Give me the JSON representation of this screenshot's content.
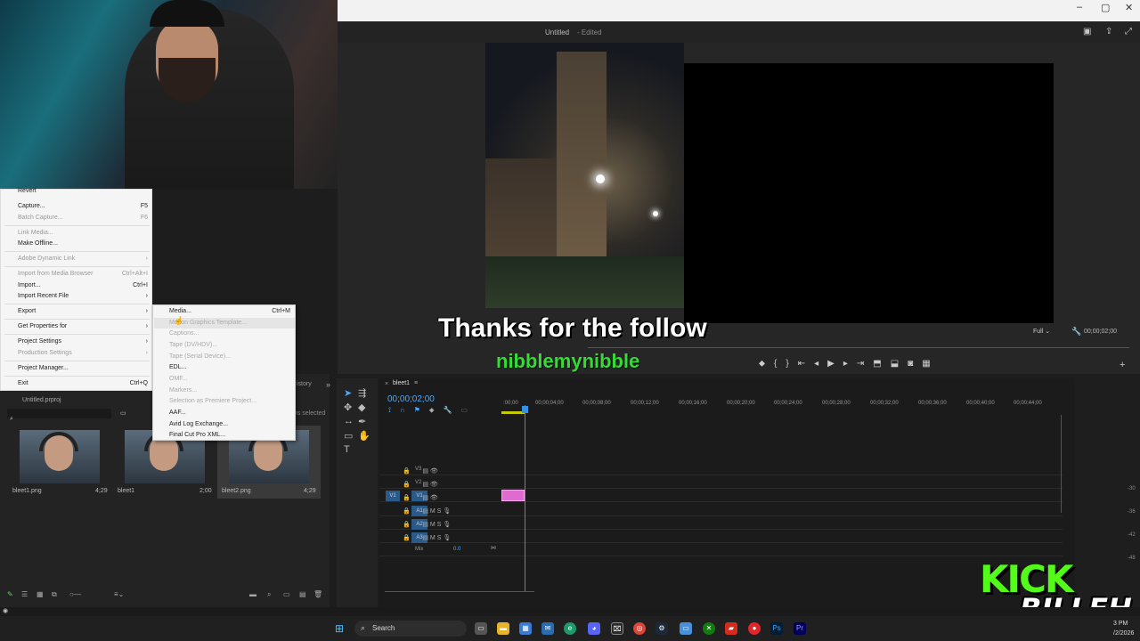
{
  "window": {
    "title": "Untitled",
    "state": "Edited"
  },
  "file_menu": {
    "items": [
      {
        "label": "Revert",
        "shortcut": "",
        "disabled": false
      },
      {
        "label": "Capture...",
        "shortcut": "F5",
        "disabled": false
      },
      {
        "label": "Batch Capture...",
        "shortcut": "F6",
        "disabled": true
      },
      {
        "label": "Link Media...",
        "shortcut": "",
        "disabled": true
      },
      {
        "label": "Make Offline...",
        "shortcut": "",
        "disabled": false
      },
      {
        "label": "Adobe Dynamic Link",
        "shortcut": "›",
        "disabled": true
      },
      {
        "label": "Import from Media Browser",
        "shortcut": "Ctrl+Alt+I",
        "disabled": true
      },
      {
        "label": "Import...",
        "shortcut": "Ctrl+I",
        "disabled": false
      },
      {
        "label": "Import Recent File",
        "shortcut": "›",
        "disabled": false
      },
      {
        "label": "Export",
        "shortcut": "›",
        "disabled": false
      },
      {
        "label": "Get Properties for",
        "shortcut": "›",
        "disabled": false
      },
      {
        "label": "Project Settings",
        "shortcut": "›",
        "disabled": false
      },
      {
        "label": "Production Settings",
        "shortcut": "›",
        "disabled": true
      },
      {
        "label": "Project Manager...",
        "shortcut": "",
        "disabled": false
      },
      {
        "label": "Exit",
        "shortcut": "Ctrl+Q",
        "disabled": false
      }
    ]
  },
  "export_menu": {
    "items": [
      {
        "label": "Media...",
        "shortcut": "Ctrl+M",
        "disabled": false
      },
      {
        "label": "Motion Graphics Template...",
        "shortcut": "",
        "disabled": true
      },
      {
        "label": "Captions...",
        "shortcut": "",
        "disabled": true
      },
      {
        "label": "Tape (DV/HDV)...",
        "shortcut": "",
        "disabled": true
      },
      {
        "label": "Tape (Serial Device)...",
        "shortcut": "",
        "disabled": true
      },
      {
        "label": "EDL...",
        "shortcut": "",
        "disabled": false
      },
      {
        "label": "OMF...",
        "shortcut": "",
        "disabled": true
      },
      {
        "label": "Markers...",
        "shortcut": "",
        "disabled": true
      },
      {
        "label": "Selection as Premiere Project...",
        "shortcut": "",
        "disabled": true
      },
      {
        "label": "AAF...",
        "shortcut": "",
        "disabled": false
      },
      {
        "label": "Avid Log Exchange...",
        "shortcut": "",
        "disabled": false
      },
      {
        "label": "Final Cut Pro XML...",
        "shortcut": "",
        "disabled": false
      }
    ]
  },
  "overlay": {
    "follow_text": "Thanks for the follow",
    "username": "nibblemynibble"
  },
  "program_monitor": {
    "fit": "Full",
    "timecode": "00;00;02;00"
  },
  "project_panel": {
    "tab_partial": "istory",
    "project_file": "Untitled.prproj",
    "selection_text": "ms selected",
    "items": [
      {
        "name": "bleet1.png",
        "duration": "4;29"
      },
      {
        "name": "bleet1",
        "duration": "2;00"
      },
      {
        "name": "bleet2.png",
        "duration": "4;29"
      }
    ]
  },
  "timeline": {
    "sequence_name": "bleet1",
    "timecode": "00;00;02;00",
    "ruler": [
      ":00;00",
      "00;00;04;00",
      "00;00;08;00",
      "00;00;12;00",
      "00;00;16;00",
      "00;00;20;00",
      "00;00;24;00",
      "00;00;28;00",
      "00;00;32;00",
      "00;00;36;00",
      "00;00;40;00",
      "00;00;44;00"
    ],
    "video_tracks": [
      "V3",
      "V2",
      "V1"
    ],
    "audio_tracks": [
      "A1",
      "A2",
      "A3"
    ],
    "track_src": "V1",
    "mix_label": "Mix",
    "mix_value": "0.0"
  },
  "meter_labels": [
    "-30",
    "-36",
    "-42",
    "-48"
  ],
  "taskbar": {
    "search": "Search",
    "date_partial": "/2/2026",
    "time_partial": "3 PM"
  },
  "logo": {
    "kick": "KICK",
    "billeh": "BILLEH"
  }
}
